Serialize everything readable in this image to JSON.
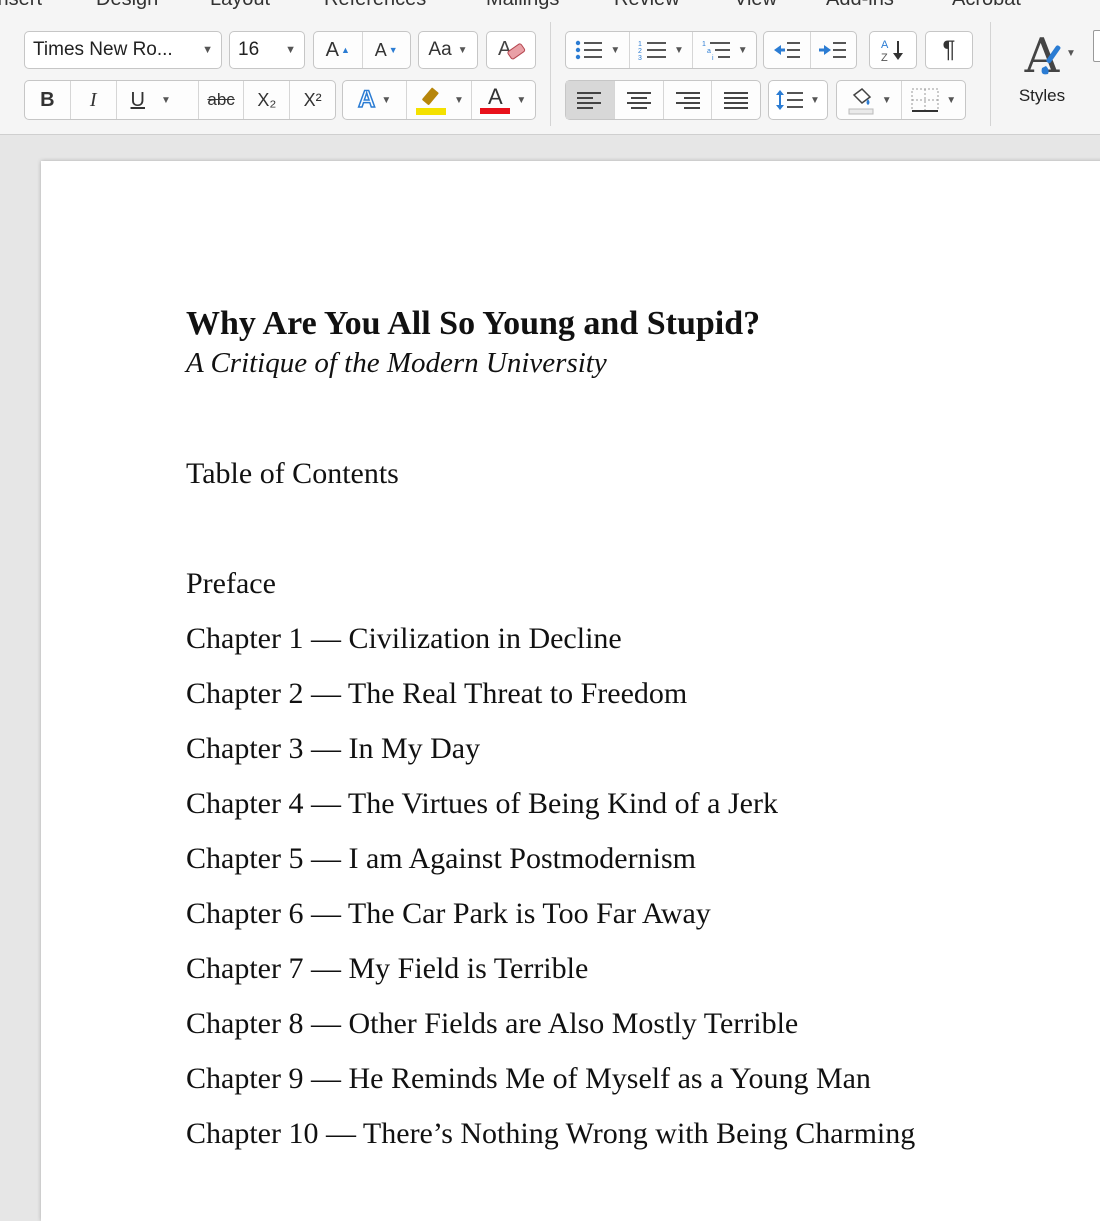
{
  "ribbon": {
    "tabs": [
      "Insert",
      "Design",
      "Layout",
      "References",
      "Mailings",
      "Review",
      "View",
      "Add-ins",
      "Acrobat"
    ],
    "font_name": "Times New Ro...",
    "font_size": "16",
    "grow_font": "A",
    "shrink_font": "A",
    "change_case": "Aa",
    "bold": "B",
    "italic": "I",
    "underline": "U",
    "strikethrough": "abc",
    "subscript": "X₂",
    "superscript": "X²",
    "text_effects": "A",
    "font_color": "A",
    "pilcrow": "¶",
    "styles_label": "Styles",
    "styles_icon": "A",
    "colors": {
      "highlight": "#f4e100",
      "font_color": "#e8101a",
      "accent_blue": "#2b7cd3"
    }
  },
  "document": {
    "title": "Why Are You All So Young and Stupid?",
    "subtitle": "A Critique of the Modern University",
    "toc_heading": "Table of Contents",
    "toc": [
      "Preface",
      "Chapter 1 — Civilization in Decline",
      "Chapter 2 — The Real Threat to Freedom",
      "Chapter 3 — In My Day",
      "Chapter 4 — The Virtues of Being Kind of a Jerk",
      "Chapter 5 — I am Against Postmodernism",
      "Chapter 6 — The Car Park is Too Far Away",
      "Chapter 7 — My Field is Terrible",
      "Chapter 8 — Other Fields are Also Mostly Terrible",
      "Chapter 9 — He Reminds Me of Myself as a Young Man",
      "Chapter 10 — There’s Nothing Wrong with Being Charming"
    ]
  }
}
